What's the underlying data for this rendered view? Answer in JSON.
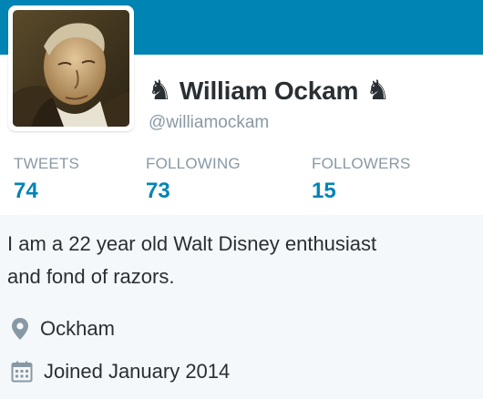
{
  "profile": {
    "name": "William Ockam",
    "handle": "@williamockam",
    "name_icon_left": "chess-knight-icon",
    "name_icon_right": "chess-knight-icon"
  },
  "stats": [
    {
      "label": "TWEETS",
      "value": "74"
    },
    {
      "label": "FOLLOWING",
      "value": "73"
    },
    {
      "label": "FOLLOWERS",
      "value": "15"
    }
  ],
  "bio": {
    "line1": "I am a 22 year old Walt Disney enthusiast",
    "line2": "and fond of razors."
  },
  "meta": {
    "location": "Ockham",
    "location_icon": "location-pin-icon",
    "joined": "Joined January 2014",
    "joined_icon": "calendar-icon"
  },
  "colors": {
    "banner": "#0084b4",
    "accent": "#0084b4",
    "text": "#292f33",
    "muted": "#8899a6",
    "background": "#f5f8fa"
  }
}
